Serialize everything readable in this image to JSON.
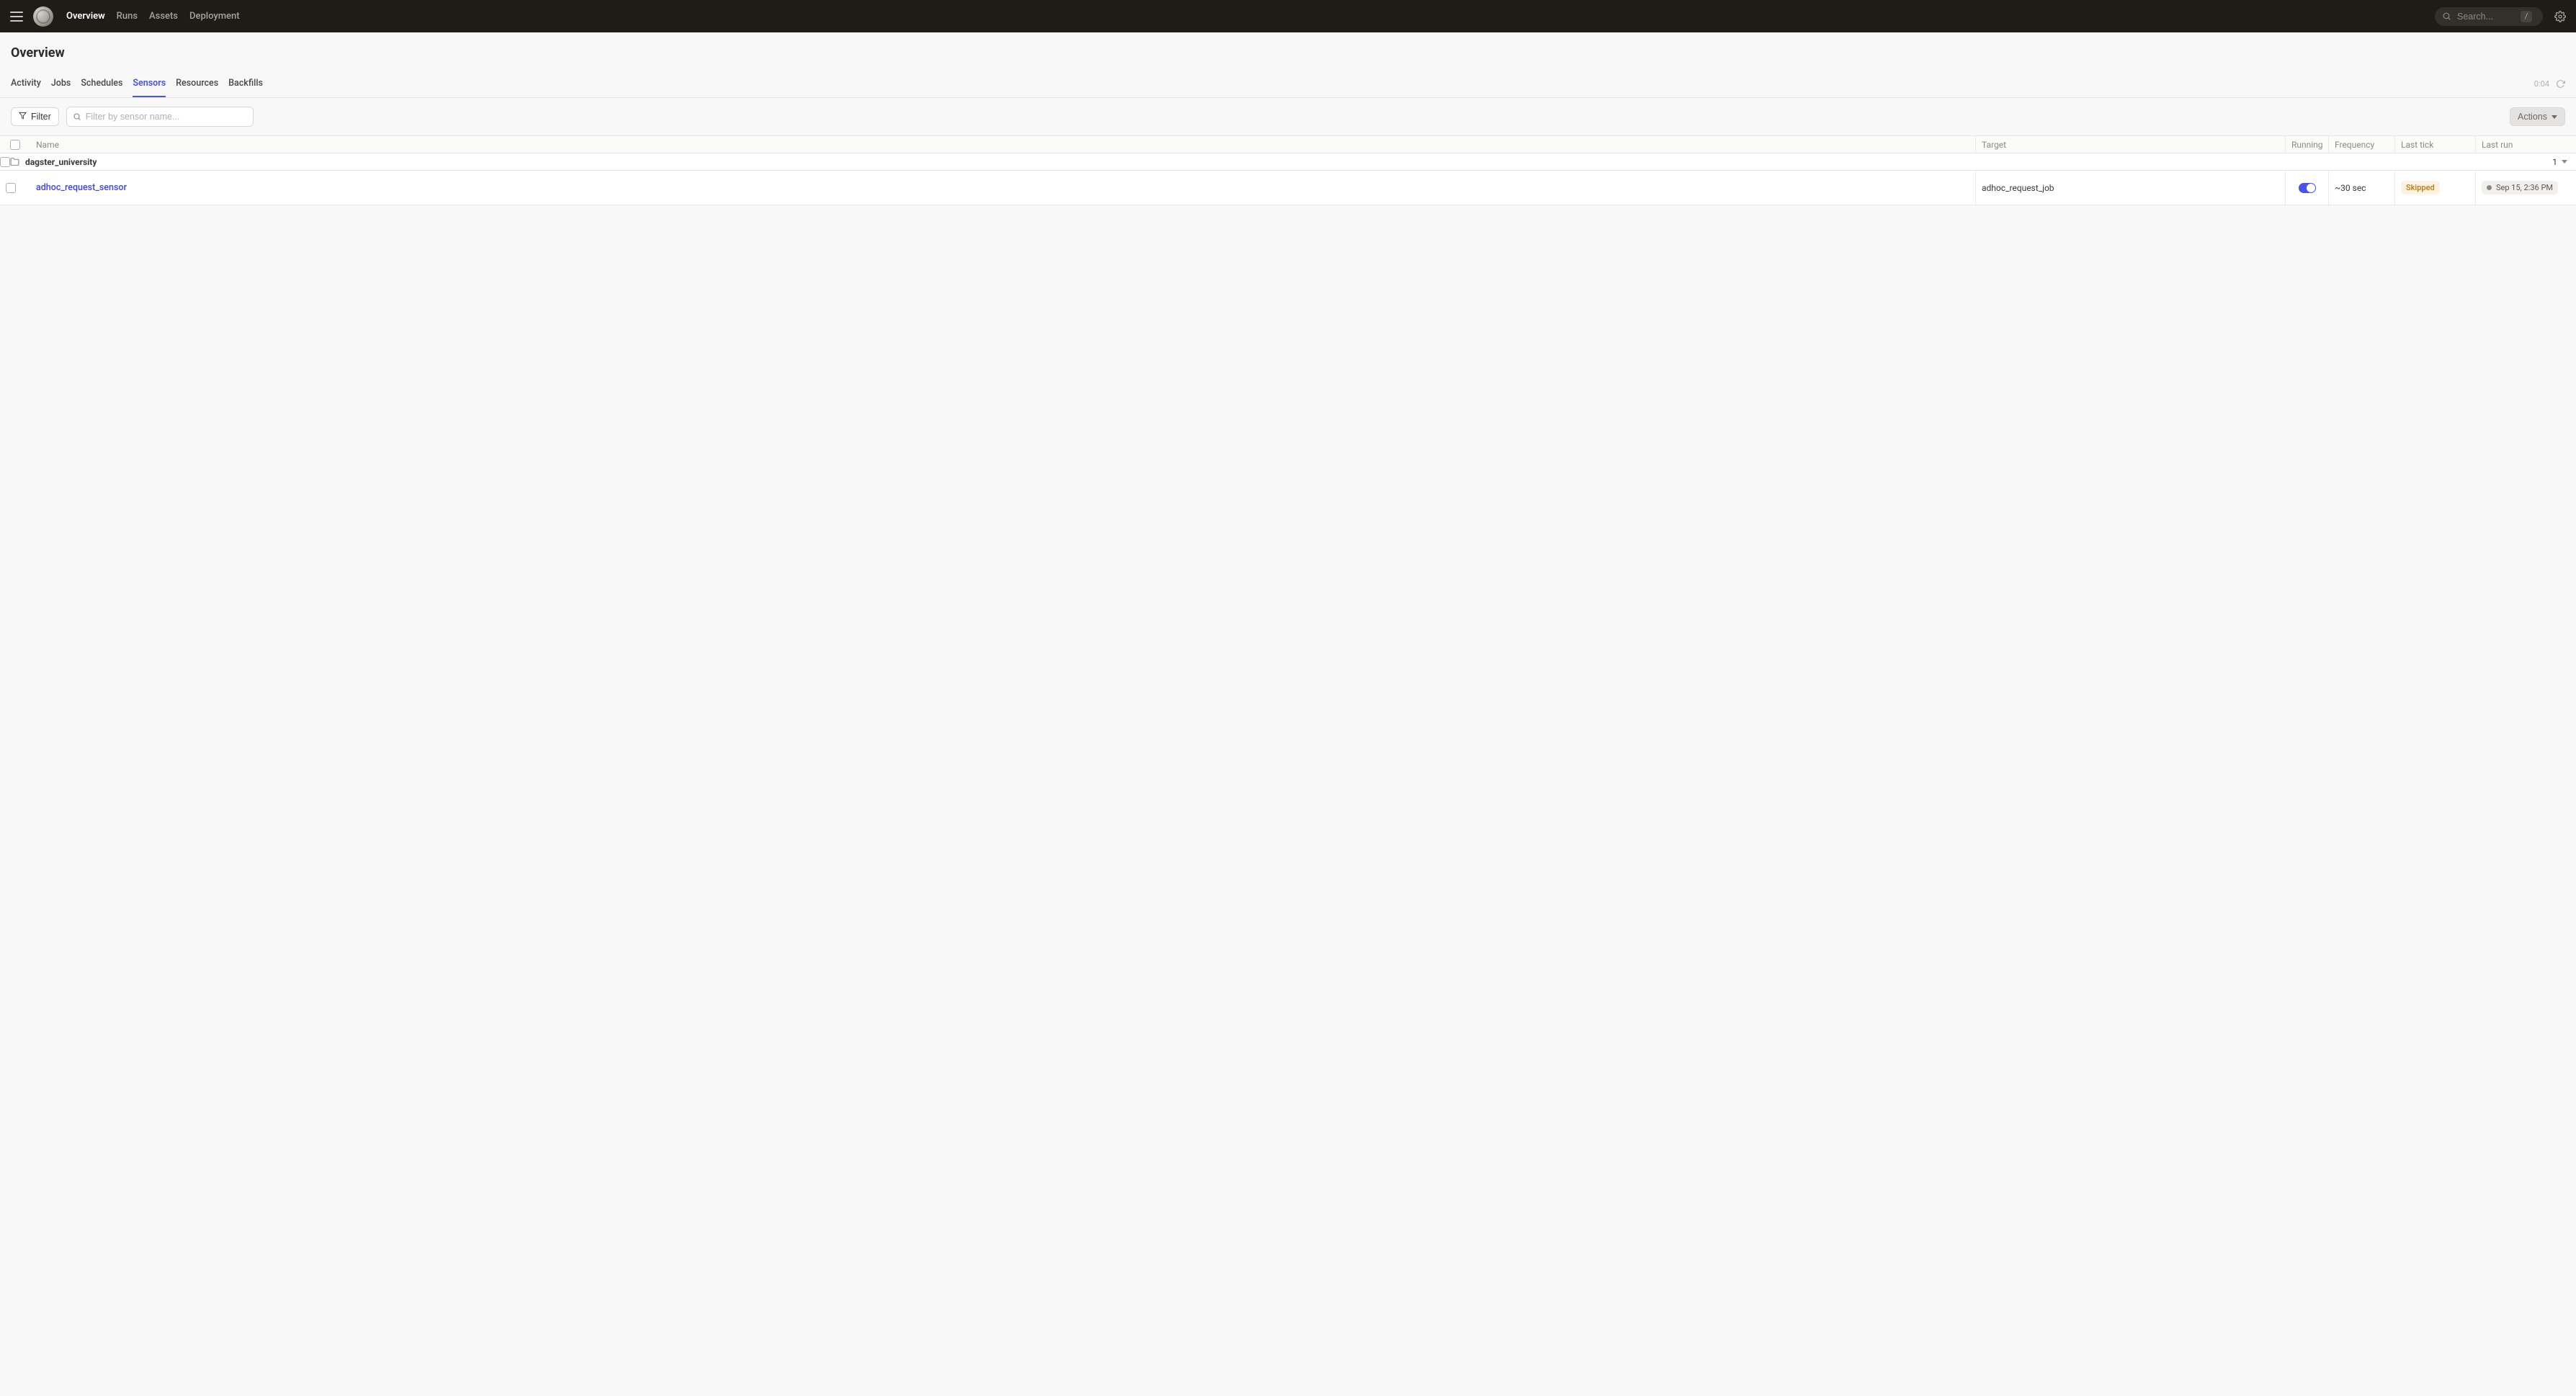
{
  "nav": {
    "links": [
      "Overview",
      "Runs",
      "Assets",
      "Deployment"
    ],
    "active_index": 0,
    "search_placeholder": "Search...",
    "search_shortcut": "/"
  },
  "page": {
    "title": "Overview",
    "tabs": [
      "Activity",
      "Jobs",
      "Schedules",
      "Sensors",
      "Resources",
      "Backfills"
    ],
    "active_tab_index": 3,
    "refresh_counter": "0:04"
  },
  "toolbar": {
    "filter_label": "Filter",
    "search_placeholder": "Filter by sensor name...",
    "actions_label": "Actions"
  },
  "table": {
    "columns": {
      "name": "Name",
      "target": "Target",
      "running": "Running",
      "frequency": "Frequency",
      "last_tick": "Last tick",
      "last_run": "Last run"
    },
    "group": {
      "label": "dagster_university",
      "count": "1"
    },
    "rows": [
      {
        "name": "adhoc_request_sensor",
        "target": "adhoc_request_job",
        "running": true,
        "frequency": "~30 sec",
        "last_tick_status": "Skipped",
        "last_run": "Sep 15, 2:36 PM"
      }
    ]
  }
}
